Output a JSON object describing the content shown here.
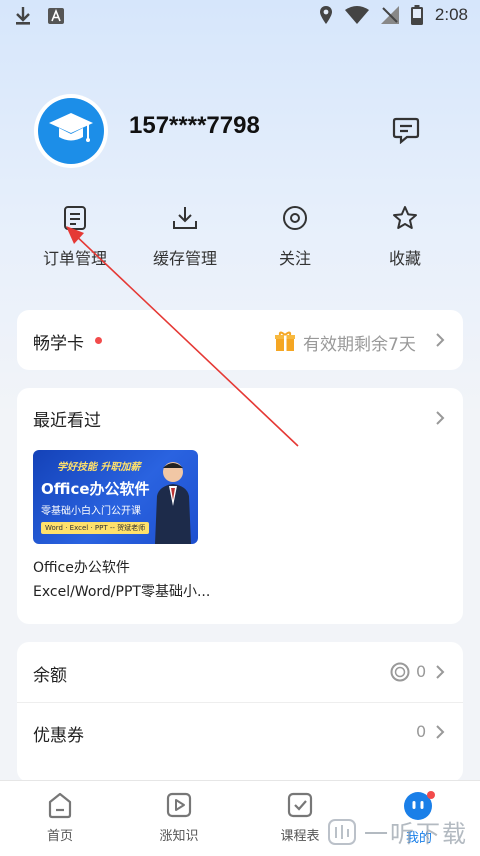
{
  "status_bar": {
    "time": "2:08",
    "left_icons": [
      "download-icon",
      "a-badge-icon"
    ],
    "right_icons": [
      "location-icon",
      "wifi-icon",
      "signal-icon",
      "battery-icon"
    ]
  },
  "profile": {
    "phone": "157****7798",
    "avatar_icon": "graduation-cap-icon",
    "message_icon": "message-icon"
  },
  "quick_actions": [
    {
      "label": "订单管理",
      "icon": "order-icon"
    },
    {
      "label": "缓存管理",
      "icon": "download-icon"
    },
    {
      "label": "关注",
      "icon": "eye-icon"
    },
    {
      "label": "收藏",
      "icon": "star-icon"
    }
  ],
  "membership": {
    "title": "畅学卡",
    "validity": "有效期剩余7天",
    "icon": "gift-icon"
  },
  "recent": {
    "title": "最近看过",
    "course": {
      "thumb_line1": "学好技能  升职加薪",
      "thumb_line2": "Office办公软件",
      "thumb_line3": "零基础小白入门公开课",
      "thumb_tag": "Word · Excel · PPT -- 贺斌老师",
      "title": "Office办公软件Excel/Word/PPT零基础小..."
    }
  },
  "wallet": [
    {
      "label": "余额",
      "value": "0",
      "icon": "coin-icon"
    },
    {
      "label": "优惠券",
      "value": "0"
    }
  ],
  "bottom_nav": [
    {
      "label": "首页",
      "icon": "home-icon",
      "active": false
    },
    {
      "label": "涨知识",
      "icon": "play-icon",
      "active": false
    },
    {
      "label": "课程表",
      "icon": "checklist-icon",
      "active": false
    },
    {
      "label": "我的",
      "icon": "profile-icon",
      "active": true
    }
  ],
  "watermark": {
    "text": "一听下载"
  },
  "colors": {
    "accent": "#1a7fe8",
    "red_dot": "#f24b4b",
    "gift": "#f5a623",
    "arrow": "#e53935"
  }
}
